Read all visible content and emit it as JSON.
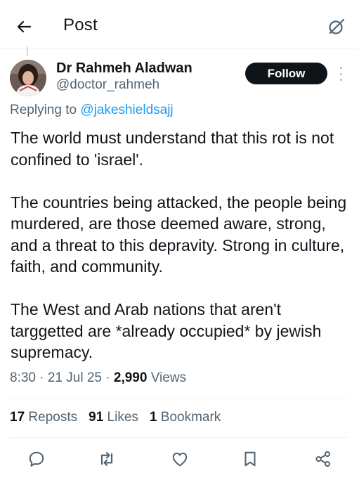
{
  "header": {
    "title": "Post"
  },
  "author": {
    "name": "Dr Rahmeh Aladwan",
    "handle": "@doctor_rahmeh"
  },
  "follow": {
    "label": "Follow"
  },
  "reply": {
    "prefix": "Replying to ",
    "mention": "@jakeshieldsajj"
  },
  "post": {
    "paragraphs": [
      "The world must understand that this rot is not confined to 'israel'.",
      "The countries being attacked, the people being murdered, are those deemed aware, strong, and a threat to this depravity. Strong in culture, faith, and community.",
      "The West and Arab nations that aren't targgetted are *already occupied* by jewish supremacy."
    ]
  },
  "meta": {
    "time": "8:30",
    "date": "21 Jul 25",
    "views_count": "2,990",
    "views_label": "Views",
    "sep": " · "
  },
  "stats": {
    "reposts_count": "17",
    "reposts_label": "Reposts",
    "likes_count": "91",
    "likes_label": "Likes",
    "bookmarks_count": "1",
    "bookmarks_label": "Bookmark"
  },
  "icons": {
    "back": "arrow-left-icon",
    "grok": "grok-icon",
    "more": "more-vertical-icon",
    "reply": "reply-icon",
    "repost": "repost-icon",
    "like": "heart-icon",
    "bookmark": "bookmark-icon",
    "share": "share-icon"
  },
  "colors": {
    "link": "#1d9bf0",
    "muted": "#536471",
    "text": "#0f1419",
    "follow_bg": "#0f1419"
  }
}
